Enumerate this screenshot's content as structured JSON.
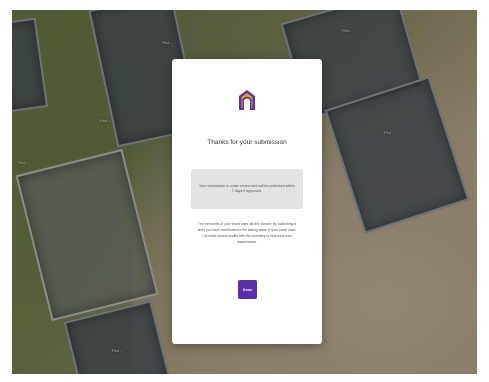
{
  "map": {
    "plot_labels": [
      {
        "text": "Plot ..."
      },
      {
        "text": "Plot ...\n..."
      },
      {
        "text": "Plot ...\n..."
      },
      {
        "text": "Plot ..."
      },
      {
        "text": "Plot ...\n..."
      },
      {
        "text": "Plot ..."
      }
    ]
  },
  "modal": {
    "logo_icon": "cemetery-logo-icon",
    "accent_color": "#5b2fa8",
    "title": "Thanks for your submission",
    "notice": "Your submission is under review and will be published within 7 days if approved.",
    "body": "The memories of your loved ones will live forever. By submitting a story you have contributed to the lasting place of your loved ones. Chronicle shares profits with the cemetery to help fund their maintenance.",
    "done_label": "Done"
  }
}
